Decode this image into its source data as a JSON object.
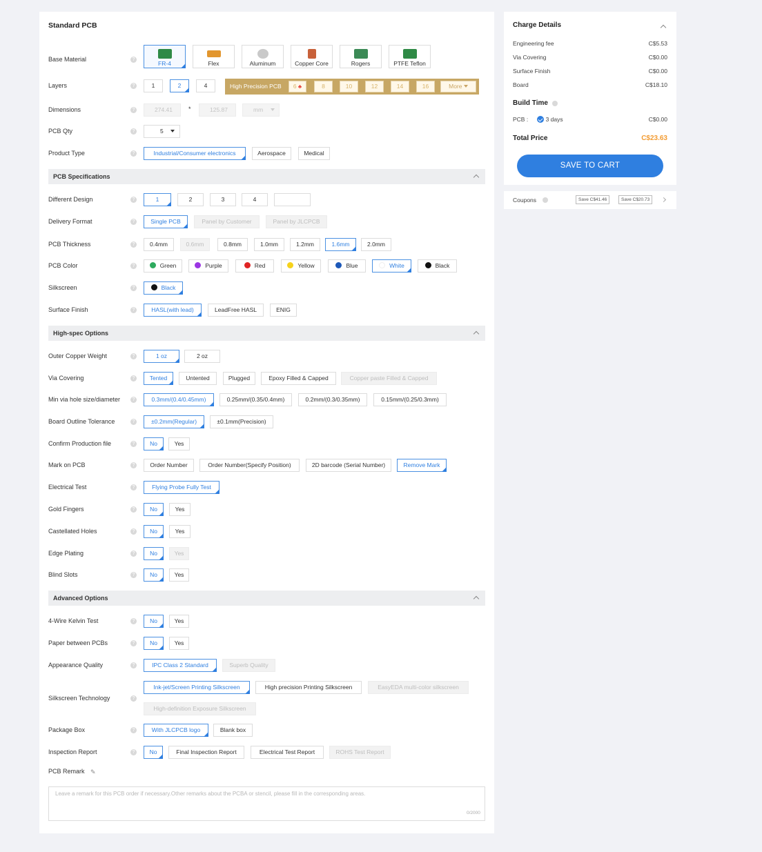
{
  "title": "Standard PCB",
  "labels": {
    "base_material": "Base Material",
    "layers": "Layers",
    "dimensions": "Dimensions",
    "pcb_qty": "PCB Qty",
    "product_type": "Product Type",
    "different_design": "Different Design",
    "delivery_format": "Delivery Format",
    "pcb_thickness": "PCB Thickness",
    "pcb_color": "PCB Color",
    "silkscreen": "Silkscreen",
    "surface_finish": "Surface Finish",
    "outer_copper": "Outer Copper Weight",
    "via_covering": "Via Covering",
    "min_via": "Min via hole size/diameter",
    "board_outline": "Board Outline Tolerance",
    "confirm_production": "Confirm Production file",
    "mark_on_pcb": "Mark on PCB",
    "electrical_test": "Electrical Test",
    "gold_fingers": "Gold Fingers",
    "castellated": "Castellated Holes",
    "edge_plating": "Edge Plating",
    "blind_slots": "Blind Slots",
    "four_wire": "4-Wire Kelvin Test",
    "paper_between": "Paper between PCBs",
    "appearance": "Appearance Quality",
    "silk_tech": "Silkscreen Technology",
    "package_box": "Package Box",
    "inspection": "Inspection Report",
    "remark": "PCB Remark"
  },
  "sections": {
    "specs": "PCB Specifications",
    "highspec": "High-spec Options",
    "advanced": "Advanced Options"
  },
  "materials": [
    "FR-4",
    "Flex",
    "Aluminum",
    "Copper Core",
    "Rogers",
    "PTFE Teflon"
  ],
  "layers": {
    "opts": [
      "1",
      "2",
      "4"
    ],
    "hp_label": "High Precision PCB",
    "hp_opts": [
      "6",
      "8",
      "10",
      "12",
      "14",
      "16"
    ],
    "more": "More"
  },
  "dimensions": {
    "width": "274.41",
    "x": "*",
    "height": "125.87",
    "unit": "mm"
  },
  "qty": "5",
  "product_type": [
    "Industrial/Consumer electronics",
    "Aerospace",
    "Medical"
  ],
  "different_design": [
    "1",
    "2",
    "3",
    "4"
  ],
  "delivery_format": [
    "Single PCB",
    "Panel by Customer",
    "Panel by JLCPCB"
  ],
  "thickness": [
    "0.4mm",
    "0.6mm",
    "0.8mm",
    "1.0mm",
    "1.2mm",
    "1.6mm",
    "2.0mm"
  ],
  "colors": [
    "Green",
    "Purple",
    "Red",
    "Yellow",
    "Blue",
    "White",
    "Black"
  ],
  "color_hex": {
    "green": "#2eaa5e",
    "purple": "#9b36e3",
    "red": "#e02424",
    "yellow": "#f6d21b",
    "blue": "#1c58b8",
    "white": "#ffffff",
    "black": "#111111",
    "accent": "#2f7fe0",
    "gold": "#c7a764",
    "total": "#f39c33"
  },
  "silkscreen": [
    "Black"
  ],
  "surface_finish": [
    "HASL(with lead)",
    "LeadFree HASL",
    "ENIG"
  ],
  "outer_copper": [
    "1 oz",
    "2 oz"
  ],
  "via_covering": [
    "Tented",
    "Untented",
    "Plugged",
    "Epoxy Filled & Capped",
    "Copper paste Filled & Capped"
  ],
  "min_via": [
    "0.3mm/(0.4/0.45mm)",
    "0.25mm/(0.35/0.4mm)",
    "0.2mm/(0.3/0.35mm)",
    "0.15mm/(0.25/0.3mm)"
  ],
  "board_outline": [
    "±0.2mm(Regular)",
    "±0.1mm(Precision)"
  ],
  "no_yes": [
    "No",
    "Yes"
  ],
  "mark_on_pcb": [
    "Order Number",
    "Order Number(Specify Position)",
    "2D barcode (Serial Number)",
    "Remove Mark"
  ],
  "electrical_test": [
    "Flying Probe Fully Test"
  ],
  "appearance": [
    "IPC Class 2 Standard",
    "Superb Quality"
  ],
  "silk_tech": [
    "Ink-jet/Screen Printing Silkscreen",
    "High precision Printing Silkscreen",
    "EasyEDA multi-color silkscreen",
    "High-definition Exposure Silkscreen"
  ],
  "package_box": [
    "With JLCPCB logo",
    "Blank box"
  ],
  "inspection": [
    "No",
    "Final Inspection Report",
    "Electrical Test Report",
    "ROHS Test Report"
  ],
  "remark": {
    "placeholder": "Leave a remark for this PCB order if necessary.Other remarks about the PCBA or stencil, please fill in the corresponding areas.",
    "counter": "0/2000"
  },
  "charges": {
    "title": "Charge Details",
    "items": [
      {
        "name": "Engineering fee",
        "value": "C$5.53"
      },
      {
        "name": "Via Covering",
        "value": "C$0.00"
      },
      {
        "name": "Surface Finish",
        "value": "C$0.00"
      },
      {
        "name": "Board",
        "value": "C$18.10"
      }
    ],
    "build_time_title": "Build Time",
    "pcb_label": "PCB :",
    "build_days": "3 days",
    "build_value": "C$0.00",
    "total_label": "Total Price",
    "total_value": "C$23.63",
    "cart_button": "SAVE TO CART"
  },
  "coupons": {
    "label": "Coupons",
    "items": [
      "Save C$41.46",
      "Save C$20.73"
    ]
  }
}
